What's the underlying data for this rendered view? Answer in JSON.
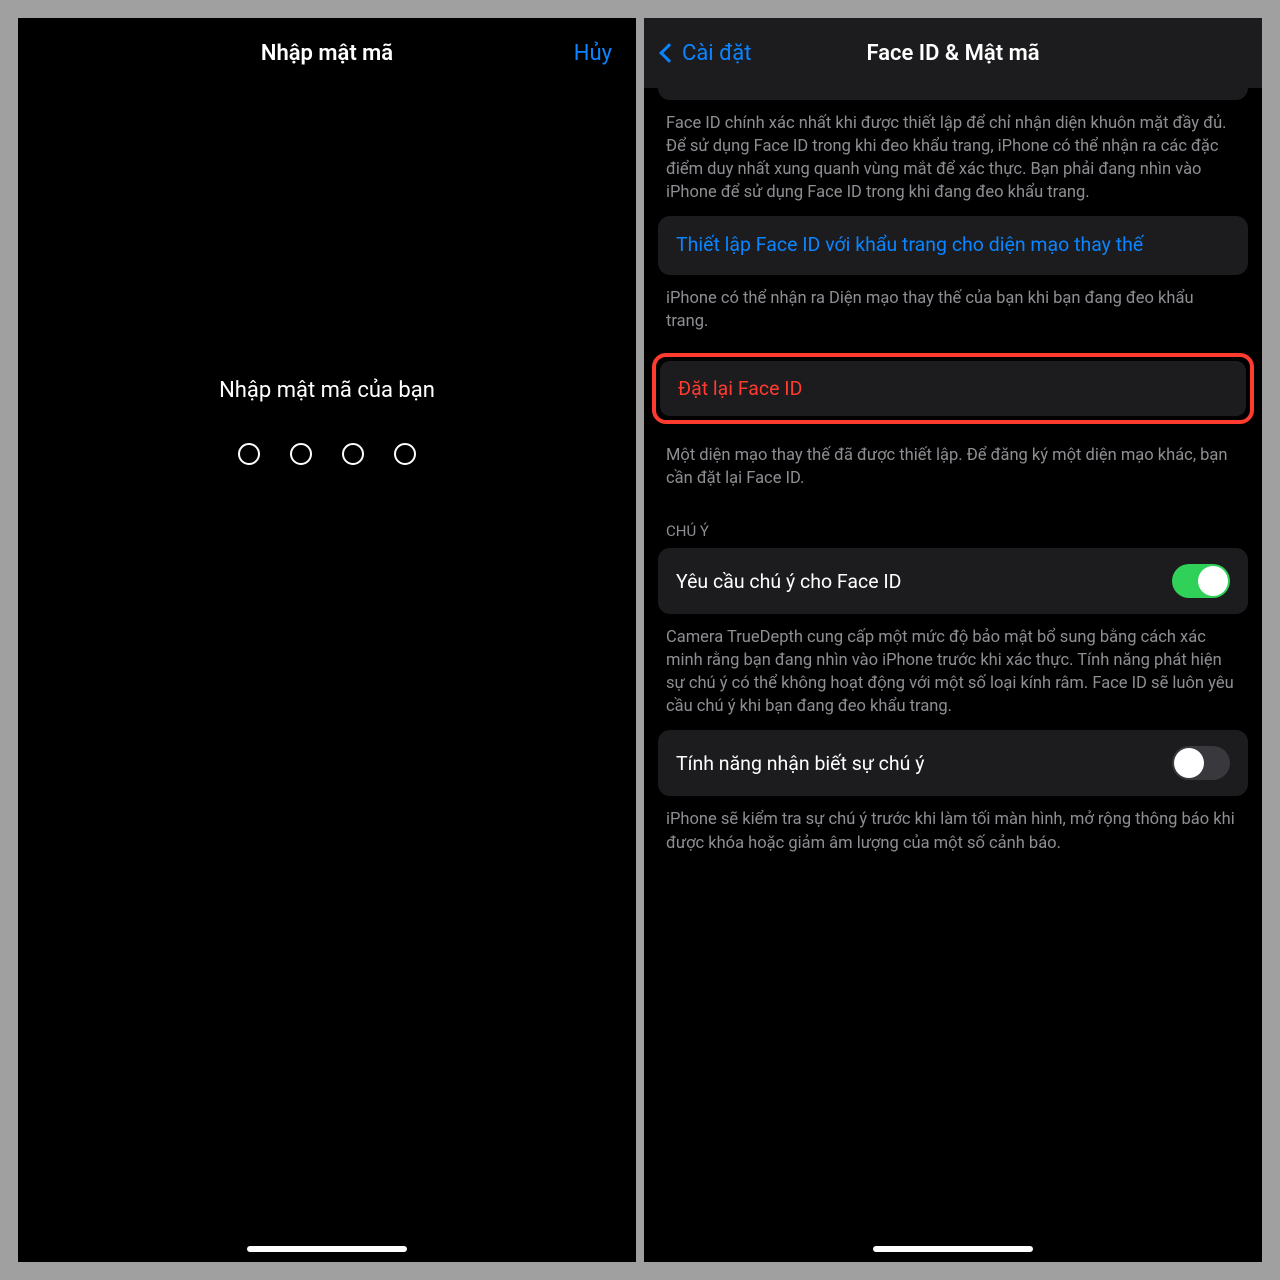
{
  "left": {
    "title": "Nhập mật mã",
    "cancel": "Hủy",
    "prompt": "Nhập mật mã của bạn"
  },
  "right": {
    "back": "Cài đặt",
    "title": "Face ID & Mật mã",
    "desc1": "Face ID chính xác nhất khi được thiết lập để chỉ nhận diện khuôn mặt đầy đủ. Để sử dụng Face ID trong khi đeo khẩu trang, iPhone có thể nhận ra các đặc điểm duy nhất xung quanh vùng mắt để xác thực. Bạn phải đang nhìn vào iPhone để sử dụng Face ID trong khi đang đeo khẩu trang.",
    "setup_mask": "Thiết lập Face ID với khẩu trang cho diện mạo thay thế",
    "desc2": "iPhone có thể nhận ra Diện mạo thay thế của bạn khi bạn đang đeo khẩu trang.",
    "reset": "Đặt lại Face ID",
    "desc3": "Một diện mạo thay thế đã được thiết lập. Để đăng ký một diện mạo khác, bạn cần đặt lại Face ID.",
    "attention_header": "CHÚ Ý",
    "require_attention": "Yêu cầu chú ý cho Face ID",
    "desc4": "Camera TrueDepth cung cấp một mức độ bảo mật bổ sung bằng cách xác minh rằng bạn đang nhìn vào iPhone trước khi xác thực. Tính năng phát hiện sự chú ý có thể không hoạt động với một số loại kính râm. Face ID sẽ luôn yêu cầu chú ý khi bạn đang đeo khẩu trang.",
    "attention_aware": "Tính năng nhận biết sự chú ý",
    "desc5": "iPhone sẽ kiểm tra sự chú ý trước khi làm tối màn hình, mở rộng thông báo khi được khóa hoặc giảm âm lượng của một số cảnh báo."
  }
}
